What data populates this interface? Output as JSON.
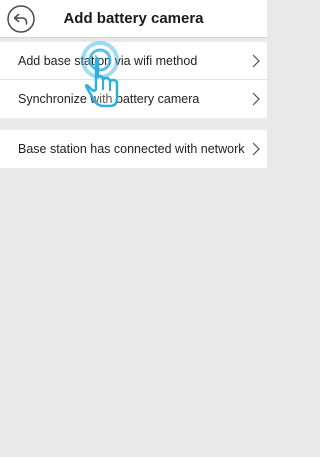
{
  "header": {
    "title": "Add battery camera",
    "back_icon": "back-arrow-circle-icon"
  },
  "menu": {
    "items": [
      {
        "label": "Add base station via wifi method",
        "icon": "chevron-right-icon"
      },
      {
        "label": "Synchronize with battery camera",
        "icon": "chevron-right-icon"
      },
      {
        "label": "Base station has connected with network",
        "icon": "chevron-right-icon"
      }
    ]
  },
  "overlay": {
    "icon": "tap-hand-icon",
    "color": "#2bb0e0"
  },
  "colors": {
    "background": "#e9e9e9",
    "surface": "#ffffff",
    "accent": "#2bb0e0"
  }
}
